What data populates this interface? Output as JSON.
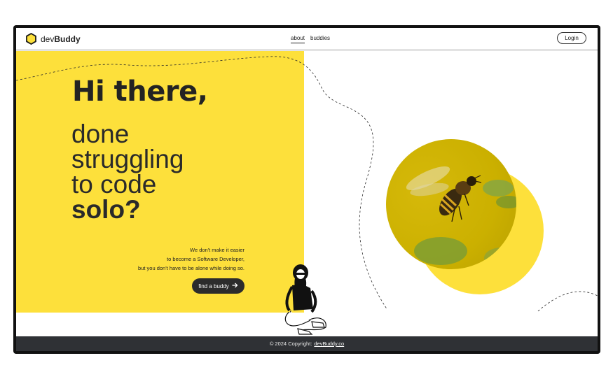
{
  "nav": {
    "brand_light": "dev",
    "brand_bold": "Buddy",
    "links": [
      "about",
      "buddies"
    ],
    "login_label": "Login"
  },
  "hero": {
    "greeting": "Hi there,",
    "line1": "done",
    "line2": "struggling",
    "line3": "to code",
    "line4": "solo?",
    "tagline": [
      "We don't make it easier",
      "to become a Software Developer,",
      "but you don't have to be alone while doing so."
    ],
    "cta_label": "find a buddy",
    "cta_icon": "arrow-right-icon"
  },
  "footer": {
    "text": "© 2024 Copyright:",
    "link": "devBuddy.co"
  },
  "colors": {
    "accent_yellow": "#fde03b",
    "dark": "#2c2c2c",
    "footer_bg": "#2f3135"
  }
}
